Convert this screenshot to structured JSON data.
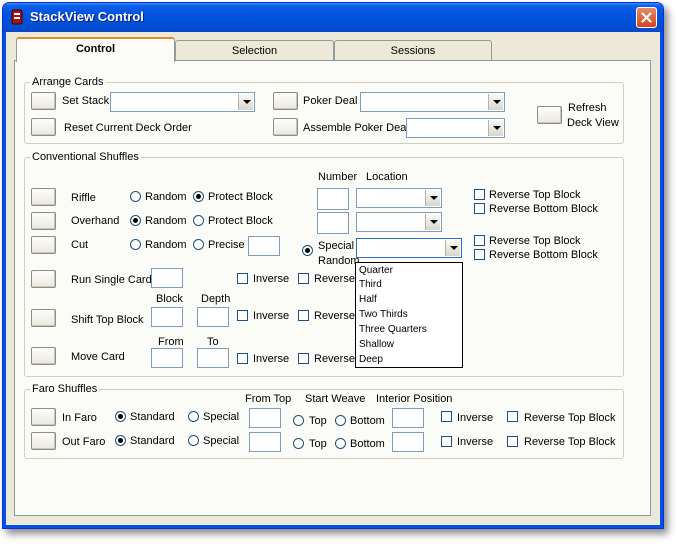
{
  "window": {
    "title": "StackView Control"
  },
  "tabs": [
    {
      "label": "Control"
    },
    {
      "label": "Selection"
    },
    {
      "label": "Sessions"
    }
  ],
  "arrange_cards": {
    "group_label": "Arrange Cards",
    "set_stack_label": "Set Stack",
    "reset_label": "Reset Current Deck Order",
    "poker_deal_label": "Poker Deal",
    "assemble_label": "Assemble Poker Deal",
    "refresh_label_1": "Refresh",
    "refresh_label_2": "Deck View"
  },
  "conventional": {
    "group_label": "Conventional Shuffles",
    "col_number": "Number",
    "col_location": "Location",
    "riffle": "Riffle",
    "overhand": "Overhand",
    "cut": "Cut",
    "run_single": "Run Single Cards",
    "shift_top_block": "Shift Top Block",
    "move_card": "Move Card",
    "random": "Random",
    "protect_block": "Protect Block",
    "precise": "Precise",
    "special": "Special",
    "random2": "Random",
    "reverse_top_block": "Reverse Top Block",
    "reverse_bottom_block": "Reverse Bottom Block",
    "inverse": "Inverse",
    "reverse_truncated_1": "Reverse R",
    "reverse_truncated_2": "Reverse T",
    "reverse_truncated_3": "Reverse C",
    "block_label": "Block",
    "depth_label": "Depth",
    "from_label": "From",
    "to_label": "To",
    "location_options": [
      "Quarter",
      "Third",
      "Half",
      "Two Thirds",
      "Three Quarters",
      "Shallow",
      "Deep"
    ]
  },
  "faro": {
    "group_label": "Faro Shuffles",
    "from_top": "From Top",
    "start_weave": "Start Weave",
    "interior_position": "Interior Position",
    "in_faro": "In Faro",
    "out_faro": "Out Faro",
    "standard": "Standard",
    "special": "Special",
    "top": "Top",
    "bottom": "Bottom",
    "inverse": "Inverse",
    "reverse_top_block": "Reverse Top Block"
  },
  "colors": {
    "titlebar": "#0353e0",
    "face": "#ece9d8",
    "tab_highlight": "#e68b2c"
  }
}
